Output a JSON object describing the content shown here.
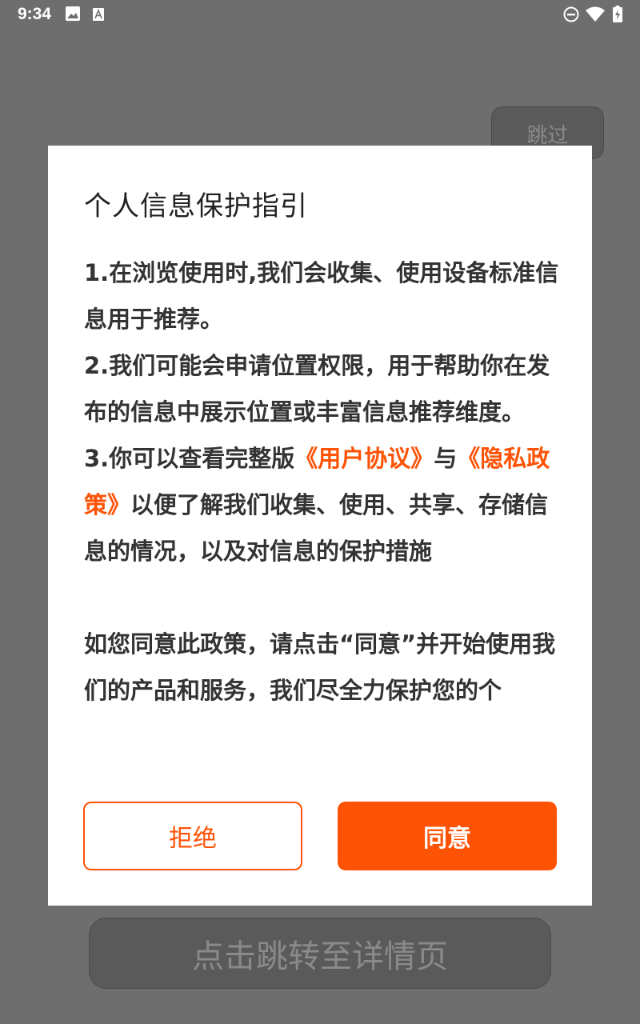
{
  "status_bar": {
    "time": "9:34",
    "icons": [
      "image-icon",
      "a-notification-icon",
      "dnd-icon",
      "wifi-icon",
      "battery-charging-icon"
    ]
  },
  "background": {
    "skip_label": "跳过",
    "detail_label": "点击跳转至详情页"
  },
  "dialog": {
    "title": "个人信息保护指引",
    "p1": "1.在浏览使用时,我们会收集、使用设备标准信息用于推荐。",
    "p2": "2.我们可能会申请位置权限，用于帮助你在发布的信息中展示位置或丰富信息推荐维度。",
    "p3_prefix": "3.你可以查看完整版",
    "user_agreement_link": "《用户协议》",
    "p3_and": "与",
    "privacy_policy_link": "《隐私政策》",
    "p3_suffix": "以便了解我们收集、使用、共享、存储信息的情况，以及对信息的保护措施",
    "p4": "如您同意此政策，请点击“同意”并开始使用我们的产品和服务，我们尽全力保护您的个",
    "reject_label": "拒绝",
    "agree_label": "同意"
  },
  "colors": {
    "accent": "#fe5205",
    "overlay": "#6e6e6e"
  }
}
